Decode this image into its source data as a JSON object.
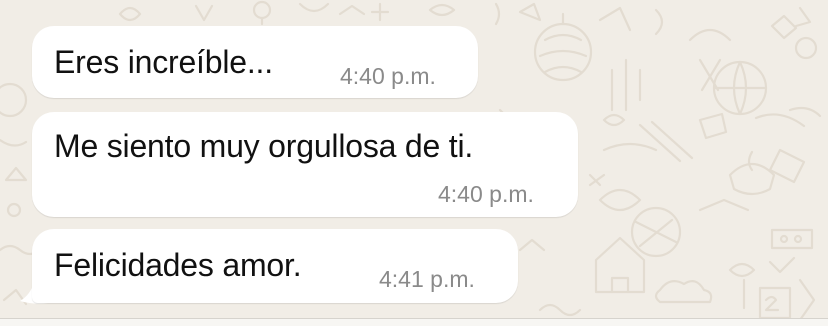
{
  "messages": [
    {
      "text": "Eres increíble...",
      "time": "4:40 p.m."
    },
    {
      "text": "Me siento muy orgullosa de ti.",
      "time": "4:40 p.m."
    },
    {
      "text": "Felicidades amor.",
      "time": "4:41 p.m."
    }
  ],
  "colors": {
    "wallpaper": "#f1ede6",
    "doodles": "#e4ddd3",
    "bubble": "#ffffff",
    "text": "#111111",
    "timestamp": "#8a8a8a"
  },
  "icons": [
    "balloon-doodle",
    "globe-doodle",
    "lantern-doodle",
    "diya-doodle",
    "house-doodle",
    "cloud-doodle",
    "chopsticks-doodle",
    "star-doodle",
    "flower-doodle",
    "calendar-doodle"
  ]
}
